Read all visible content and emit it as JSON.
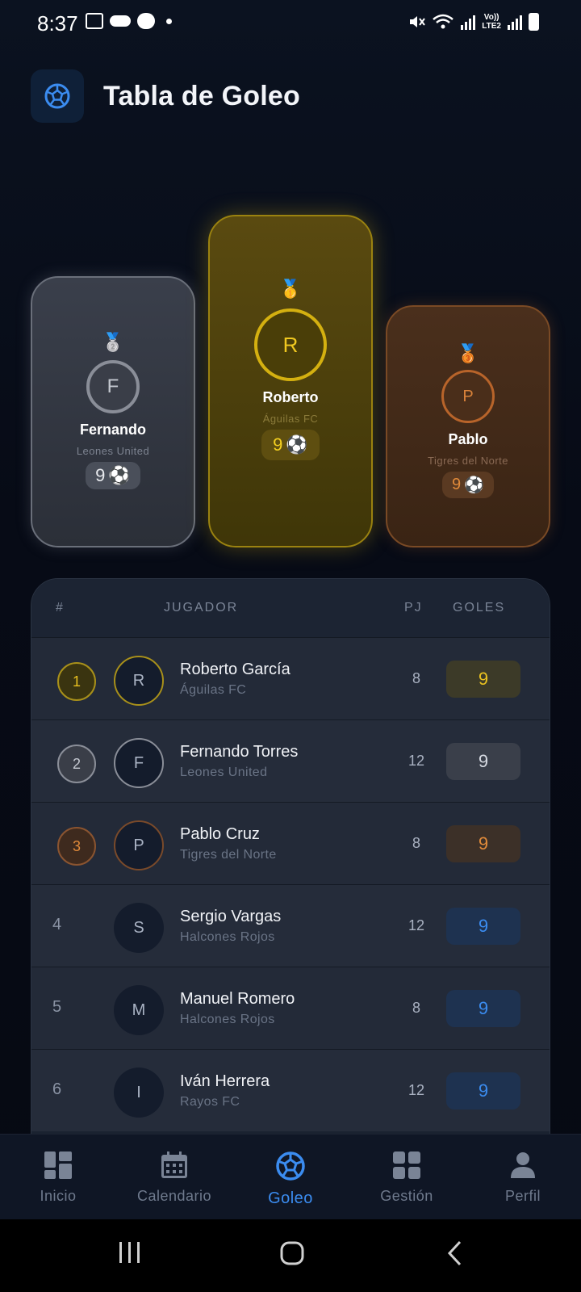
{
  "status_bar": {
    "time": "8:37",
    "volte_label": "Vo))\nLTE2"
  },
  "header": {
    "title": "Tabla de Goleo",
    "logo_icon": "soccer-ball-icon"
  },
  "podium": {
    "first": {
      "initial": "R",
      "name": "Roberto",
      "team": "Águilas FC",
      "goals": "9",
      "medal": "🥇"
    },
    "second": {
      "initial": "F",
      "name": "Fernando",
      "team": "Leones United",
      "goals": "9",
      "medal": "🥈"
    },
    "third": {
      "initial": "P",
      "name": "Pablo",
      "team": "Tigres del Norte",
      "goals": "9",
      "medal": "🥉"
    },
    "ball": "⚽"
  },
  "table": {
    "headers": {
      "rank": "#",
      "player": "JUGADOR",
      "pj": "PJ",
      "goals": "GOLES"
    },
    "rows": [
      {
        "rank": "1",
        "initial": "R",
        "name": "Roberto García",
        "team": "Águilas FC",
        "pj": "8",
        "goals": "9"
      },
      {
        "rank": "2",
        "initial": "F",
        "name": "Fernando Torres",
        "team": "Leones United",
        "pj": "12",
        "goals": "9"
      },
      {
        "rank": "3",
        "initial": "P",
        "name": "Pablo Cruz",
        "team": "Tigres del Norte",
        "pj": "8",
        "goals": "9"
      },
      {
        "rank": "4",
        "initial": "S",
        "name": "Sergio Vargas",
        "team": "Halcones Rojos",
        "pj": "12",
        "goals": "9"
      },
      {
        "rank": "5",
        "initial": "M",
        "name": "Manuel Romero",
        "team": "Halcones Rojos",
        "pj": "8",
        "goals": "9"
      },
      {
        "rank": "6",
        "initial": "I",
        "name": "Iván Herrera",
        "team": "Rayos FC",
        "pj": "12",
        "goals": "9"
      }
    ]
  },
  "bottom_nav": {
    "items": [
      {
        "label": "Inicio",
        "icon": "dashboard-icon"
      },
      {
        "label": "Calendario",
        "icon": "calendar-icon"
      },
      {
        "label": "Goleo",
        "icon": "soccer-ball-icon",
        "active": true
      },
      {
        "label": "Gestión",
        "icon": "grid-icon"
      },
      {
        "label": "Perfil",
        "icon": "person-icon"
      }
    ]
  },
  "colors": {
    "gold": "#e8c020",
    "silver": "#b8bcc6",
    "bronze": "#d9823a",
    "accent_blue": "#3b8cf0"
  }
}
